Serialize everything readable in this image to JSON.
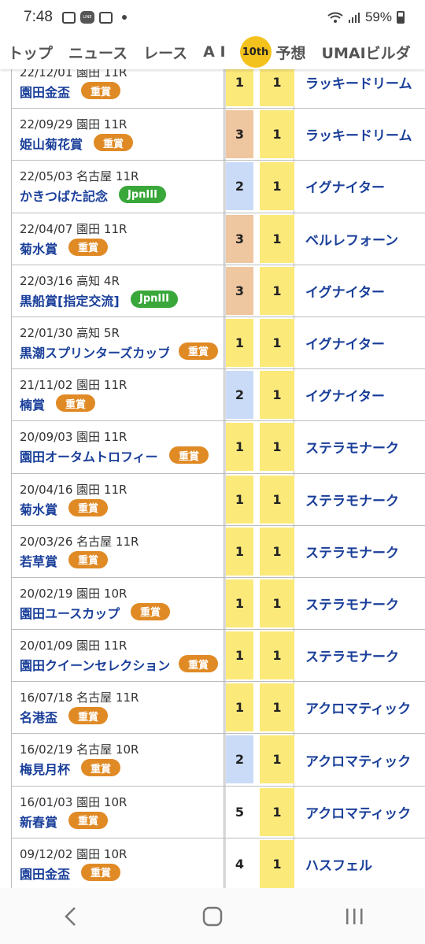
{
  "status": {
    "time": "7:48",
    "battery": "59%"
  },
  "nav": {
    "items": [
      "トップ",
      "ニュース",
      "レース",
      "A I"
    ],
    "badge": "10th",
    "items_after": [
      "予想",
      "UMAIビルダ"
    ]
  },
  "rows": [
    {
      "meta": "22/12/01 園田 11R",
      "name": "園田金盃",
      "badge": "重賞",
      "badge_type": "juusho",
      "pos": "1",
      "win": "1",
      "horse": "ラッキードリーム"
    },
    {
      "meta": "22/09/29 園田 11R",
      "name": "姫山菊花賞",
      "badge": "重賞",
      "badge_type": "juusho",
      "pos": "3",
      "win": "1",
      "horse": "ラッキードリーム"
    },
    {
      "meta": "22/05/03 名古屋 11R",
      "name": "かきつばた記念",
      "badge": "JpnIII",
      "badge_type": "jpn",
      "pos": "2",
      "win": "1",
      "horse": "イグナイター"
    },
    {
      "meta": "22/04/07 園田 11R",
      "name": "菊水賞",
      "badge": "重賞",
      "badge_type": "juusho",
      "pos": "3",
      "win": "1",
      "horse": "ベルレフォーン"
    },
    {
      "meta": "22/03/16 高知 4R",
      "name": "黒船賞[指定交流]",
      "badge": "JpnIII",
      "badge_type": "jpn",
      "pos": "3",
      "win": "1",
      "horse": "イグナイター"
    },
    {
      "meta": "22/01/30 高知 5R",
      "name": "黒潮スプリンターズカップ",
      "badge": "重賞",
      "badge_type": "juusho",
      "pos": "1",
      "win": "1",
      "horse": "イグナイター"
    },
    {
      "meta": "21/11/02 園田 11R",
      "name": "楠賞",
      "badge": "重賞",
      "badge_type": "juusho",
      "pos": "2",
      "win": "1",
      "horse": "イグナイター"
    },
    {
      "meta": "20/09/03 園田 11R",
      "name": "園田オータムトロフィー",
      "badge": "重賞",
      "badge_type": "juusho",
      "pos": "1",
      "win": "1",
      "horse": "ステラモナーク"
    },
    {
      "meta": "20/04/16 園田 11R",
      "name": "菊水賞",
      "badge": "重賞",
      "badge_type": "juusho",
      "pos": "1",
      "win": "1",
      "horse": "ステラモナーク"
    },
    {
      "meta": "20/03/26 名古屋 11R",
      "name": "若草賞",
      "badge": "重賞",
      "badge_type": "juusho",
      "pos": "1",
      "win": "1",
      "horse": "ステラモナーク"
    },
    {
      "meta": "20/02/19 園田 10R",
      "name": "園田ユースカップ",
      "badge": "重賞",
      "badge_type": "juusho",
      "pos": "1",
      "win": "1",
      "horse": "ステラモナーク"
    },
    {
      "meta": "20/01/09 園田 11R",
      "name": "園田クイーンセレクション",
      "badge": "重賞",
      "badge_type": "juusho",
      "pos": "1",
      "win": "1",
      "horse": "ステラモナーク"
    },
    {
      "meta": "16/07/18 名古屋 11R",
      "name": "名港盃",
      "badge": "重賞",
      "badge_type": "juusho",
      "pos": "1",
      "win": "1",
      "horse": "アクロマティック"
    },
    {
      "meta": "16/02/19 名古屋 10R",
      "name": "梅見月杯",
      "badge": "重賞",
      "badge_type": "juusho",
      "pos": "2",
      "win": "1",
      "horse": "アクロマティック"
    },
    {
      "meta": "16/01/03 園田 10R",
      "name": "新春賞",
      "badge": "重賞",
      "badge_type": "juusho",
      "pos": "5",
      "win": "1",
      "horse": "アクロマティック"
    },
    {
      "meta": "09/12/02 園田 10R",
      "name": "園田金盃",
      "badge": "重賞",
      "badge_type": "juusho",
      "pos": "4",
      "win": "1",
      "horse": "ハスフェル"
    }
  ],
  "colors": {
    "first": "#fbe97a",
    "second": "#c9dbf7",
    "third": "#eec6a0",
    "juusho": "#e08a25",
    "jpn": "#3aa73a",
    "link": "#1a3f9a"
  }
}
